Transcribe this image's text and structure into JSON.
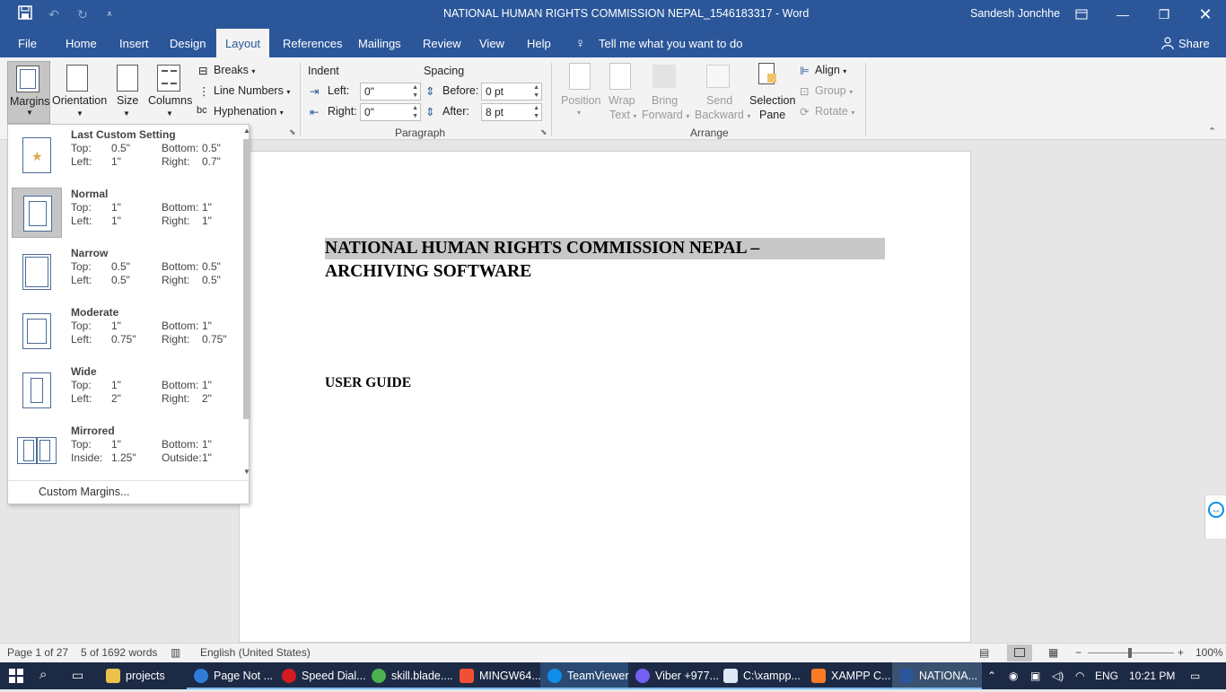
{
  "window": {
    "title": "NATIONAL HUMAN RIGHTS COMMISSION NEPAL_1546183317  -  Word",
    "user": "Sandesh Jonchhe"
  },
  "tabs": [
    "File",
    "Home",
    "Insert",
    "Design",
    "Layout",
    "References",
    "Mailings",
    "Review",
    "View",
    "Help"
  ],
  "active_tab": "Layout",
  "tell_me": "Tell me what you want to do",
  "share": "Share",
  "page_setup": {
    "margins": "Margins",
    "orientation": "Orientation",
    "size": "Size",
    "columns": "Columns",
    "breaks": "Breaks",
    "line_numbers": "Line Numbers",
    "hyphenation": "Hyphenation"
  },
  "paragraph": {
    "group_label": "Paragraph",
    "indent_label": "Indent",
    "spacing_label": "Spacing",
    "left_label": "Left:",
    "left_value": "0\"",
    "right_label": "Right:",
    "right_value": "0\"",
    "before_label": "Before:",
    "before_value": "0 pt",
    "after_label": "After:",
    "after_value": "8 pt"
  },
  "arrange": {
    "group_label": "Arrange",
    "position": "Position",
    "wrap_text_1": "Wrap",
    "wrap_text_2": "Text",
    "bring_forward_1": "Bring",
    "bring_forward_2": "Forward",
    "send_backward_1": "Send",
    "send_backward_2": "Backward",
    "selection_pane_1": "Selection",
    "selection_pane_2": "Pane",
    "align": "Align",
    "group": "Group",
    "rotate": "Rotate"
  },
  "margins_menu": {
    "items": [
      {
        "name": "Last Custom Setting",
        "top": "0.5\"",
        "bottom": "0.5\"",
        "left_label": "Left:",
        "left": "1\"",
        "right_label": "Right:",
        "right": "0.7\""
      },
      {
        "name": "Normal",
        "top": "1\"",
        "bottom": "1\"",
        "left_label": "Left:",
        "left": "1\"",
        "right_label": "Right:",
        "right": "1\""
      },
      {
        "name": "Narrow",
        "top": "0.5\"",
        "bottom": "0.5\"",
        "left_label": "Left:",
        "left": "0.5\"",
        "right_label": "Right:",
        "right": "0.5\""
      },
      {
        "name": "Moderate",
        "top": "1\"",
        "bottom": "1\"",
        "left_label": "Left:",
        "left": "0.75\"",
        "right_label": "Right:",
        "right": "0.75\""
      },
      {
        "name": "Wide",
        "top": "1\"",
        "bottom": "1\"",
        "left_label": "Left:",
        "left": "2\"",
        "right_label": "Right:",
        "right": "2\""
      },
      {
        "name": "Mirrored",
        "top": "1\"",
        "bottom": "1\"",
        "left_label": "Inside:",
        "left": "1.25\"",
        "right_label": "Outside:",
        "right": "1\""
      }
    ],
    "top_label": "Top:",
    "bottom_label": "Bottom:",
    "custom": "Custom Margins..."
  },
  "document": {
    "title_line1": "NATIONAL    HUMAN    RIGHTS    COMMISSION    NEPAL    –",
    "title_line2": "ARCHIVING SOFTWARE",
    "subtitle": "USER GUIDE"
  },
  "status": {
    "page": "Page 1 of 27",
    "words": "5 of 1692 words",
    "language": "English (United States)",
    "zoom": "100%"
  },
  "taskbar": {
    "items": [
      "projects",
      "Page Not ...",
      "Speed Dial...",
      "skill.blade....",
      "MINGW64...",
      "TeamViewer",
      "Viber +977...",
      "C:\\xampp...",
      "XAMPP C...",
      "NATIONA..."
    ],
    "lang": "ENG",
    "time": "10:21 PM"
  }
}
